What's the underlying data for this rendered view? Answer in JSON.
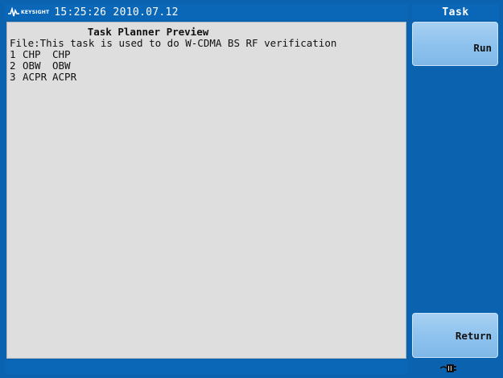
{
  "header": {
    "brand": "KEYSIGHT",
    "datetime": "15:25:26 2010.07.12",
    "menu_title": "Task"
  },
  "panel": {
    "title": "Task Planner Preview",
    "file_line": "File:This task is used to do W-CDMA BS RF verification",
    "tasks": [
      {
        "num": "1",
        "name": "CHP",
        "desc": "CHP"
      },
      {
        "num": "2",
        "name": "OBW",
        "desc": "OBW"
      },
      {
        "num": "3",
        "name": "ACPR",
        "desc": "ACPR"
      }
    ]
  },
  "softkeys": {
    "run": "Run",
    "return": "Return"
  },
  "status": {
    "icon": "power-plug-icon"
  },
  "colors": {
    "background": "#0b63b0",
    "panel": "#dedede",
    "softkey": "#8fc3ee"
  }
}
